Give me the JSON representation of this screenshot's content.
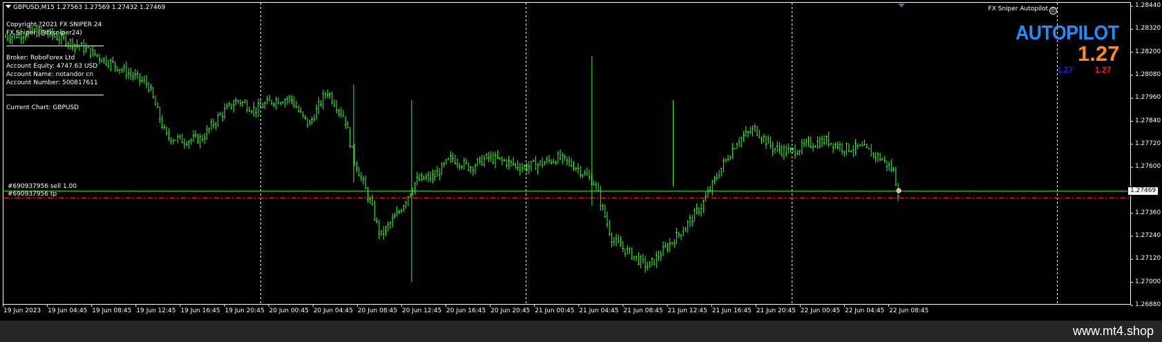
{
  "header": {
    "symbol": "GBPUSD,M15  1.27563 1.27569 1.27432 1.27469",
    "indicator_name": "FX Sniper Autopilot"
  },
  "info_panel": {
    "copyright": "Copyright ?2021 FX SNIPER 24",
    "author": "FX Sniper (@fxsniper24)",
    "broker": "Broker: RoboForex Ltd",
    "equity": "Account Equity: 4747.63 USD",
    "account_name": "Account Name: notandor cn",
    "account_number": "Account Number: 500817611",
    "current_chart": "Current Chart: GBPUSD"
  },
  "autopilot": {
    "title": "AUTOPILOT",
    "value": "1.27",
    "blue_value": "1.27",
    "red_value": "1.27",
    "colors": {
      "title": "#1f8fff",
      "value": "#ff8c1a",
      "blue": "#1a1aff",
      "red": "#ff1a1a"
    }
  },
  "orders": {
    "sell_label": "#690937956 sell 1.00",
    "tp_label": "#690937956 tp",
    "sell_price": 1.27469,
    "tp_price": 1.274
  },
  "current_price_tag": "1.27469",
  "price_axis": [
    "1.28440",
    "1.28320",
    "1.28200",
    "1.28080",
    "1.27960",
    "1.27840",
    "1.27720",
    "1.27600",
    "1.27360",
    "1.27240",
    "1.27120",
    "1.27000",
    "1.26880"
  ],
  "time_axis": [
    "19 Jun 2023",
    "19 Jun 04:45",
    "19 Jun 08:45",
    "19 Jun 12:45",
    "19 Jun 16:45",
    "19 Jun 20:45",
    "20 Jun 00:45",
    "20 Jun 04:45",
    "20 Jun 08:45",
    "20 Jun 12:45",
    "20 Jun 16:45",
    "20 Jun 20:45",
    "21 Jun 00:45",
    "21 Jun 04:45",
    "21 Jun 08:45",
    "21 Jun 12:45",
    "21 Jun 16:45",
    "21 Jun 20:45",
    "22 Jun 00:45",
    "22 Jun 04:45",
    "22 Jun 08:45"
  ],
  "chart_data": {
    "type": "line",
    "symbol": "GBPUSD",
    "timeframe": "M15",
    "candle_color": "#33ff33",
    "ylim": [
      1.2688,
      1.2846
    ],
    "anchors": [
      [
        0,
        1.2828
      ],
      [
        4,
        1.2831
      ],
      [
        8,
        1.2824
      ],
      [
        12,
        1.2814
      ],
      [
        16,
        1.2803
      ],
      [
        18,
        1.2776
      ],
      [
        20,
        1.2774
      ],
      [
        22,
        1.2775
      ],
      [
        24,
        1.2787
      ],
      [
        26,
        1.2795
      ],
      [
        28,
        1.279
      ],
      [
        30,
        1.2795
      ],
      [
        32,
        1.2796
      ],
      [
        33,
        1.2788
      ],
      [
        34,
        1.2782
      ],
      [
        36,
        1.28
      ],
      [
        38,
        1.2786
      ],
      [
        39,
        1.2765
      ],
      [
        41,
        1.274
      ],
      [
        42,
        1.2724
      ],
      [
        44,
        1.2736
      ],
      [
        46,
        1.2753
      ],
      [
        48,
        1.2755
      ],
      [
        50,
        1.2765
      ],
      [
        52,
        1.276
      ],
      [
        54,
        1.2765
      ],
      [
        56,
        1.2763
      ],
      [
        58,
        1.276
      ],
      [
        60,
        1.2762
      ],
      [
        62,
        1.2765
      ],
      [
        64,
        1.276
      ],
      [
        66,
        1.2752
      ],
      [
        68,
        1.2722
      ],
      [
        70,
        1.2715
      ],
      [
        72,
        1.2708
      ],
      [
        74,
        1.2718
      ],
      [
        76,
        1.2728
      ],
      [
        78,
        1.274
      ],
      [
        80,
        1.2758
      ],
      [
        82,
        1.2774
      ],
      [
        84,
        1.278
      ],
      [
        86,
        1.277
      ],
      [
        88,
        1.2768
      ],
      [
        90,
        1.2772
      ],
      [
        92,
        1.2774
      ],
      [
        94,
        1.277
      ],
      [
        96,
        1.277
      ],
      [
        98,
        1.2765
      ],
      [
        99.5,
        1.2758
      ],
      [
        100,
        1.2747
      ]
    ]
  }
}
